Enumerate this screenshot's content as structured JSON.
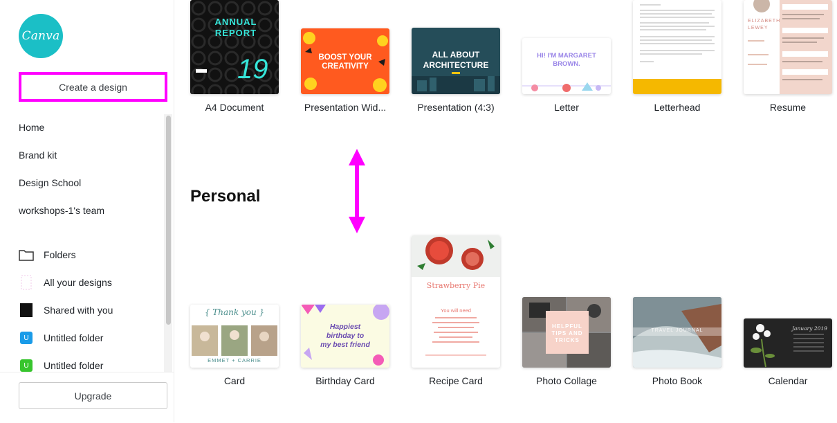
{
  "sidebar": {
    "logo_text": "Canva",
    "create_label": "Create a design",
    "nav": [
      "Home",
      "Brand kit",
      "Design School",
      "workshops-1's team"
    ],
    "folders": [
      {
        "label": "Folders",
        "icon": "folder-icon"
      },
      {
        "label": "All your designs",
        "icon": "designs-icon"
      },
      {
        "label": "Shared with you",
        "icon": "shared-icon"
      },
      {
        "label": "Untitled folder",
        "icon": "folder-blue-icon",
        "letter": "U"
      },
      {
        "label": "Untitled folder",
        "icon": "folder-green-icon",
        "letter": "U"
      }
    ],
    "upgrade_label": "Upgrade"
  },
  "top_designs": [
    {
      "label": "A4 Document",
      "thumb_text": [
        "ANNUAL",
        "REPORT",
        "19"
      ]
    },
    {
      "label": "Presentation Wid...",
      "thumb_text": [
        "BOOST YOUR",
        "CREATIVITY"
      ]
    },
    {
      "label": "Presentation (4:3)",
      "thumb_text": [
        "ALL ABOUT",
        "ARCHITECTURE"
      ]
    },
    {
      "label": "Letter",
      "thumb_text": [
        "HI! I'M MARGARET",
        "BROWN."
      ]
    },
    {
      "label": "Letterhead"
    },
    {
      "label": "Resume",
      "thumb_text": [
        "ELIZABETH",
        "LEWEY"
      ]
    }
  ],
  "section_personal": "Personal",
  "personal_designs": [
    {
      "label": "Card",
      "thumb_text": [
        "{ Thank you }",
        "EMMET + CARRIE"
      ]
    },
    {
      "label": "Birthday Card",
      "thumb_text": [
        "Happiest",
        "birthday to",
        "my best friend"
      ]
    },
    {
      "label": "Recipe Card",
      "thumb_text": [
        "Strawberry Pie",
        "You will need"
      ]
    },
    {
      "label": "Photo Collage",
      "thumb_text": [
        "HELPFUL",
        "TIPS AND",
        "TRICKS"
      ]
    },
    {
      "label": "Photo Book",
      "thumb_text": [
        "TRAVEL JOURNAL"
      ]
    },
    {
      "label": "Calendar",
      "thumb_text": [
        "January 2019"
      ]
    }
  ],
  "colors": {
    "accent": "#ff00ff",
    "logo": "#1bbfc6"
  }
}
